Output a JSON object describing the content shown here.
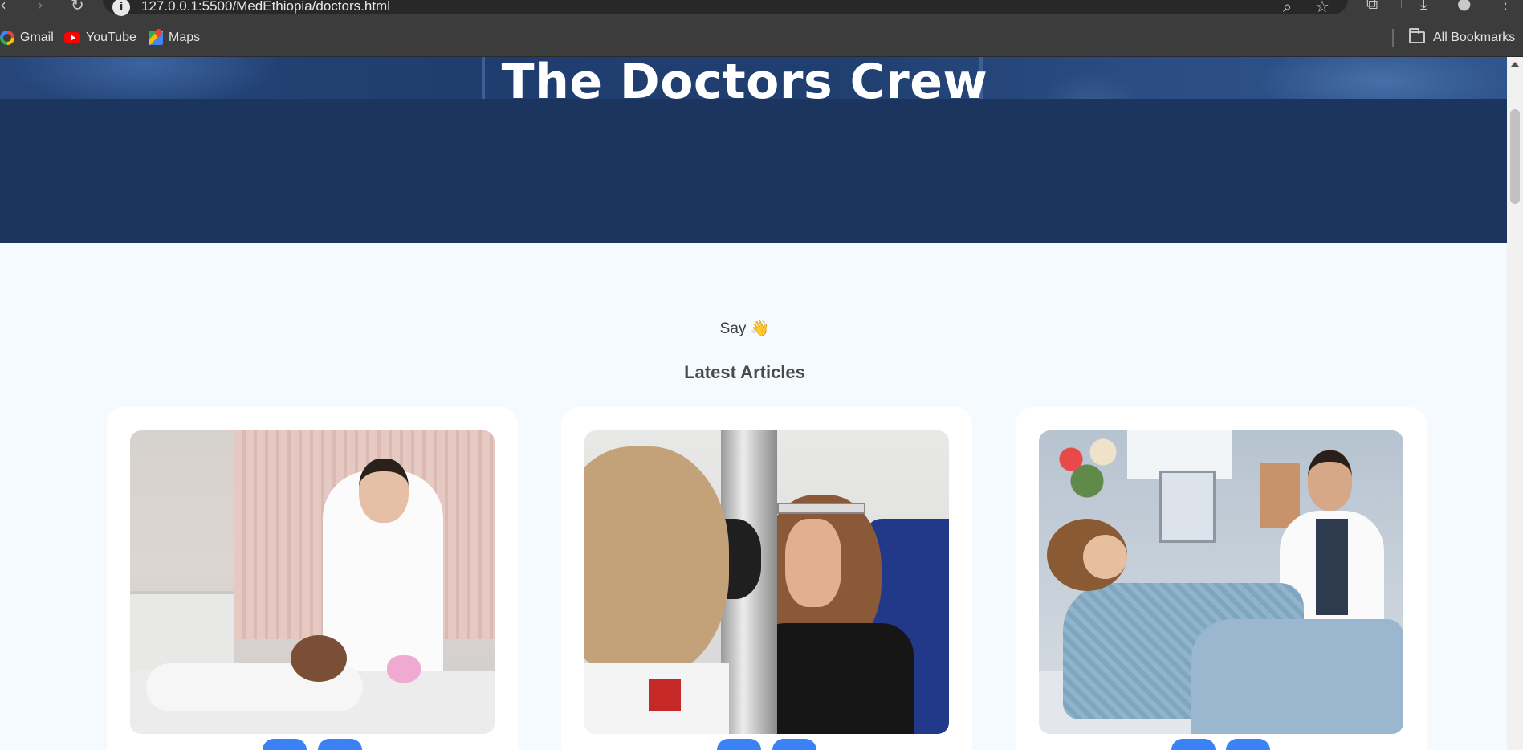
{
  "browser": {
    "url": "127.0.0.1:5500/MedEthiopia/doctors.html",
    "bookmarks": [
      {
        "label": "Gmail",
        "icon": "gmail-icon"
      },
      {
        "label": "YouTube",
        "icon": "youtube-icon"
      },
      {
        "label": "Maps",
        "icon": "maps-icon"
      }
    ],
    "all_bookmarks_label": "All Bookmarks"
  },
  "hero": {
    "title": "The Doctors Crew",
    "color": "#1b355e"
  },
  "intro": {
    "say": "Say",
    "wave": "👋"
  },
  "articles": {
    "heading": "Latest Articles",
    "cards": [
      {
        "image": "doctor-attending-patient-photo"
      },
      {
        "image": "eye-examination-photo"
      },
      {
        "image": "hospital-patient-with-doctor-photo"
      }
    ],
    "button_color": "#3b82f6"
  }
}
